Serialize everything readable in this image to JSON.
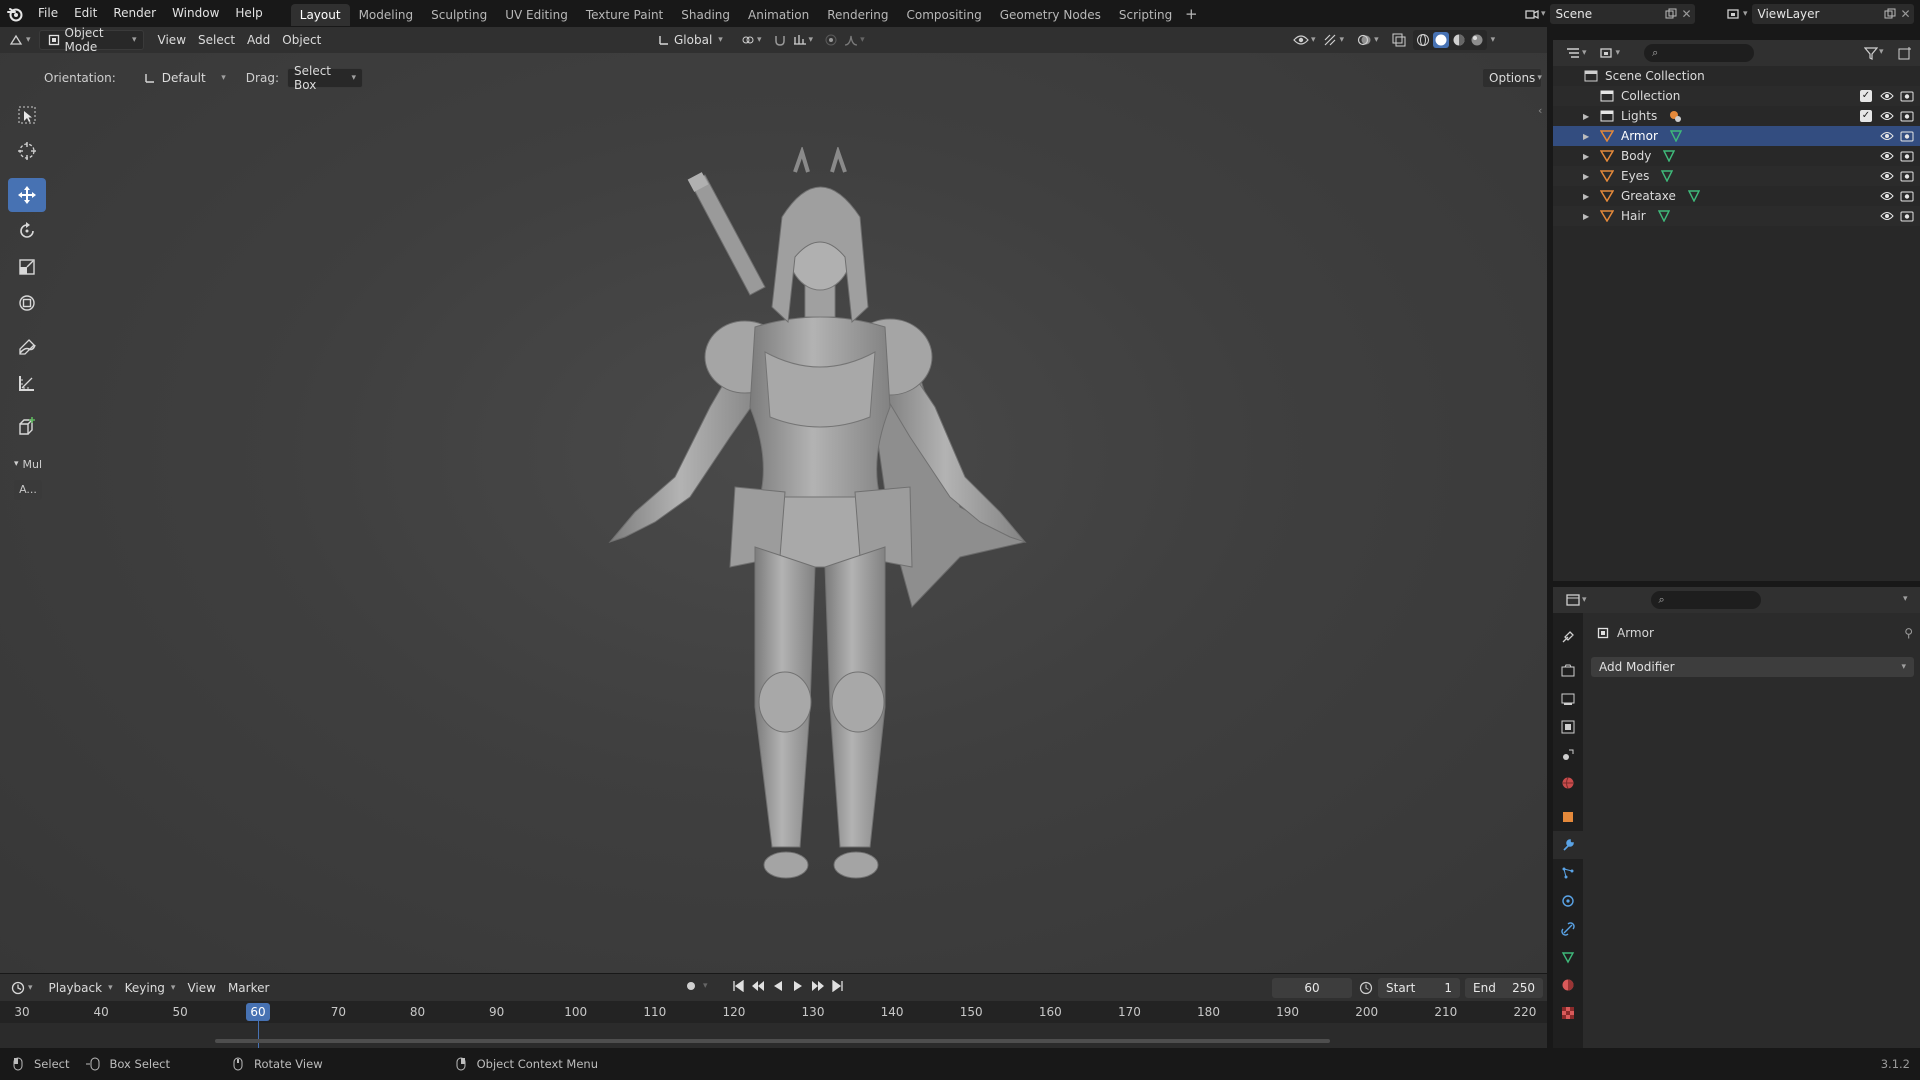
{
  "topbar": {
    "menus": [
      "File",
      "Edit",
      "Render",
      "Window",
      "Help"
    ],
    "workspaces": [
      "Layout",
      "Modeling",
      "Sculpting",
      "UV Editing",
      "Texture Paint",
      "Shading",
      "Animation",
      "Rendering",
      "Compositing",
      "Geometry Nodes",
      "Scripting"
    ],
    "active_workspace": "Layout",
    "scene_name": "Scene",
    "view_layer": "ViewLayer"
  },
  "viewport_header": {
    "mode": "Object Mode",
    "menus": [
      "View",
      "Select",
      "Add",
      "Object"
    ],
    "transform_orientation": "Global",
    "orientation_label": "Orientation:",
    "orientation_value": "Default",
    "drag_label": "Drag:",
    "drag_value": "Select Box",
    "options_label": "Options"
  },
  "toolbar": {
    "tools": [
      "select-box",
      "cursor",
      "move",
      "rotate",
      "scale",
      "transform",
      "annotate",
      "measure",
      "add-cube"
    ],
    "active_tool": "move",
    "panel_label": "Mul",
    "panel_button": "A..."
  },
  "outliner": {
    "root": "Scene Collection",
    "collection": "Collection",
    "items": [
      {
        "name": "Lights",
        "icon": "collection-icon",
        "selected": false
      },
      {
        "name": "Armor",
        "icon": "mesh-icon",
        "selected": true
      },
      {
        "name": "Body",
        "icon": "mesh-icon",
        "selected": false
      },
      {
        "name": "Eyes",
        "icon": "mesh-icon",
        "selected": false
      },
      {
        "name": "Greataxe",
        "icon": "mesh-icon",
        "selected": false
      },
      {
        "name": "Hair",
        "icon": "mesh-icon",
        "selected": false
      }
    ]
  },
  "properties": {
    "object_name": "Armor",
    "add_modifier_label": "Add Modifier"
  },
  "timeline": {
    "menus": [
      "Playback",
      "Keying",
      "View",
      "Marker"
    ],
    "current_frame": "60",
    "start_label": "Start",
    "start_value": "1",
    "end_label": "End",
    "end_value": "250",
    "ticks": [
      "30",
      "40",
      "50",
      "60",
      "70",
      "80",
      "90",
      "100",
      "110",
      "120",
      "130",
      "140",
      "150",
      "160",
      "170",
      "180",
      "190",
      "200",
      "210",
      "220"
    ]
  },
  "statusbar": {
    "select": "Select",
    "box_select": "Box Select",
    "rotate_view": "Rotate View",
    "context_menu": "Object Context Menu",
    "version": "3.1.2"
  },
  "colors": {
    "accent": "#4772b3",
    "selected_row": "#334d80",
    "mesh_icon": "#e4893b",
    "modifier_icon": "#5aa3e6",
    "vertex_group": "#3fb97a"
  }
}
